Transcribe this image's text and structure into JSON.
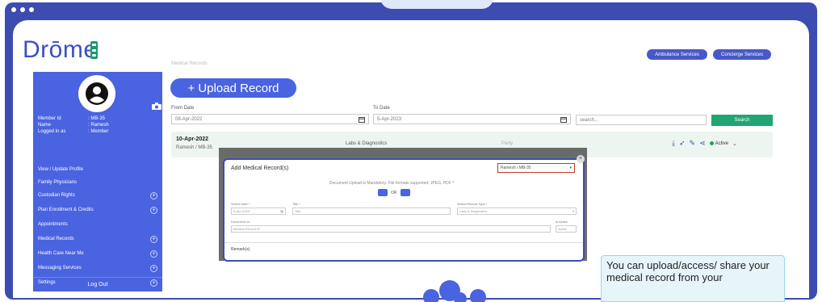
{
  "brand": {
    "name": "Drōme",
    "badge_color": "#1a9b6c",
    "brand_color": "#3b4fc4"
  },
  "header": {
    "ambulance_label": "Ambulance Services",
    "concierge_label": "Concierge Services",
    "faint_text": "Medical Records"
  },
  "sidebar": {
    "member_id_key": "Member Id",
    "member_id_val": ": MB-35",
    "name_key": "Name",
    "name_val": ": Ramesh",
    "logged_key": "Logged in as",
    "logged_val": ": Member",
    "items": [
      {
        "label": "View / Update Profile",
        "expandable": false
      },
      {
        "label": "Family Physicians",
        "expandable": false
      },
      {
        "label": "Custodian Rights",
        "expandable": true
      },
      {
        "label": "Plan Enrollment & Credits",
        "expandable": true
      },
      {
        "label": "Appointments",
        "expandable": false
      },
      {
        "label": "Medical Records",
        "expandable": true
      },
      {
        "label": "Health Care Near Me",
        "expandable": true
      },
      {
        "label": "Messaging Services",
        "expandable": true
      },
      {
        "label": "Settings",
        "expandable": true
      }
    ],
    "logout": "Log Out"
  },
  "upload": {
    "label": "+ Upload Record"
  },
  "filters": {
    "from_label": "From Date",
    "from_value": "08-Apr-2022",
    "to_label": "To Date",
    "to_value": "5-Apr-2023",
    "search_placeholder": "search...",
    "search_button": "Search"
  },
  "record": {
    "date": "10-Apr-2022",
    "who": "Ramesh / MB-35",
    "type": "Labs & Diagnostics",
    "party": "Party",
    "status": "Active"
  },
  "modal": {
    "title": "Add Medical Record(s)",
    "select_value": "Ramesh / MB-35",
    "note": "Document Upload is Mandatory. File formats supported: JPEG, PDF *",
    "toggle_label": "OR",
    "date_label": "Select Date *",
    "date_value": "5-Apr-2023",
    "title_label": "Title *",
    "title_value": "Title",
    "rtype_label": "Select Record Type *",
    "rtype_value": "Labs & Diagnostics",
    "ref_label": "Document Id",
    "ref_value": "Medical Record ID",
    "status_label": "Is Active",
    "status_value": "Active",
    "remarks_label": "Remark(s)",
    "close": "×"
  },
  "tooltip": {
    "text": "You can upload/access/ share your medical record from your"
  }
}
